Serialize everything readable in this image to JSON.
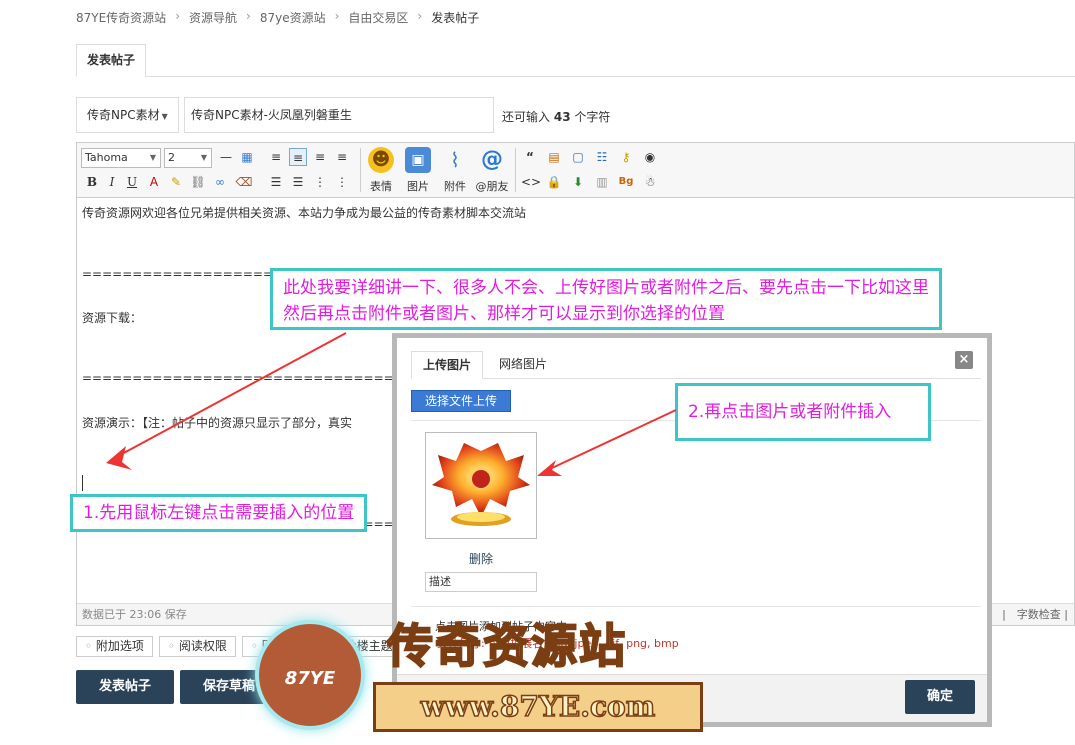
{
  "breadcrumb": [
    "87YE传奇资源站",
    "资源导航",
    "87ye资源站",
    "自由交易区",
    "发表帖子"
  ],
  "tab_label": "发表帖子",
  "post_type": "传奇NPC素材",
  "title_value": "传奇NPC素材-火凤凰列磐重生",
  "char_hint": {
    "prefix": "还可输入",
    "count": "43",
    "suffix": "个字符"
  },
  "toolbar": {
    "font": "Tahoma",
    "size": "2",
    "emoji_label": "表情",
    "image_label": "图片",
    "attach_label": "附件",
    "friend_label": "@朋友"
  },
  "content": {
    "line1": "传奇资源网欢迎各位兄弟提供相关资源、本站力争成为最公益的传奇素材脚本交流站",
    "divider1": "=======================================================",
    "download": "资源下载：",
    "divider2": "=======================================================",
    "demo": "资源演示：【注：帖子中的资源只显示了部分，真实",
    "divider3": "======================================================="
  },
  "statusbar": {
    "left": "数据已于 23:06 保存",
    "right": "据　|　字数检查 |"
  },
  "options": [
    "附加选项",
    "阅读权限",
    "回帖奖励",
    "抢楼主题"
  ],
  "buttons": {
    "post": "发表帖子",
    "draft": "保存草稿",
    "ok": "确定"
  },
  "dialog": {
    "tab_upload": "上传图片",
    "tab_web": "网络图片",
    "close": "×",
    "upload_button": "选择文件上传",
    "delete": "删除",
    "desc_placeholder": "描述",
    "hint1": "点击图片添加到帖子内容中",
    "hint2": "文件尺寸: 可用扩展名: jpg, jpeg, gif, png, bmp"
  },
  "annotations": {
    "top_line1": "此处我要详细讲一下、很多人不会、上传好图片或者附件之后、要先点击一下比如这里",
    "top_line2": "然后再点击附件或者图片、那样才可以显示到你选择的位置",
    "step1": "1.先用鼠标左键点击需要插入的位置",
    "step2": "2.再点击图片或者附件插入"
  },
  "watermark": {
    "title": "传奇资源站",
    "url": "www.87YE.com",
    "logo": "87YE"
  },
  "colors": {
    "accent": "#2b4359",
    "annotation_text": "#e01ee0",
    "annotation_border": "#3cc6c6",
    "arrow": "#ee3333",
    "upload_button": "#3b7bd6"
  }
}
